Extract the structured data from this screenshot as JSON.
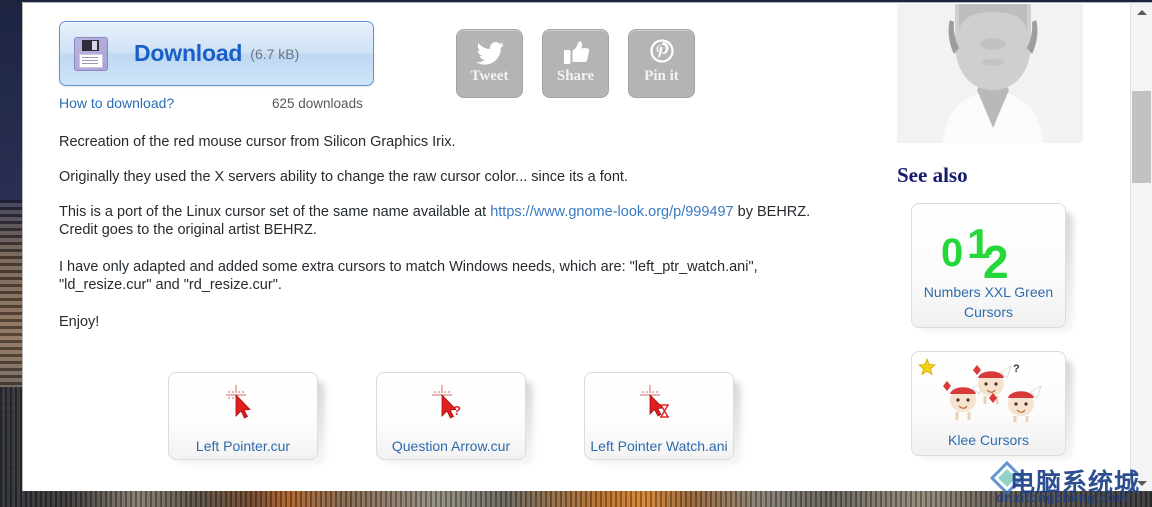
{
  "download": {
    "label": "Download",
    "size": "(6.7 kB)",
    "how_to": "How to download?",
    "count": "625 downloads",
    "icon": "floppy-disk-icon"
  },
  "social": [
    {
      "label": "Tweet",
      "icon": "twitter-bird-icon"
    },
    {
      "label": "Share",
      "icon": "thumbs-up-icon"
    },
    {
      "label": "Pin it",
      "icon": "pinterest-icon"
    }
  ],
  "description": {
    "p1": "Recreation of the red mouse cursor from Silicon Graphics Irix.",
    "p2": "Originally they used the X servers ability to change the raw cursor color... since its a font.",
    "p3_before": "This is a port of the Linux cursor set of the same name available at ",
    "p3_link": "https://www.gnome-look.org/p/999497",
    "p3_after": " by BEHRZ.",
    "p3_line2": "Credit goes to the original artist BEHRZ.",
    "p4_line1": "I have only adapted and added some extra cursors to match Windows needs, which are: \"left_ptr_watch.ani\",",
    "p4_line2": "\"ld_resize.cur\" and \"rd_resize.cur\".",
    "p5": "Enjoy!"
  },
  "previews": [
    {
      "caption": "Left Pointer.cur",
      "icon": "red-arrow-cursor-icon"
    },
    {
      "caption": "Question Arrow.cur",
      "icon": "red-arrow-question-cursor-icon"
    },
    {
      "caption": "Left Pointer Watch.ani",
      "icon": "red-arrow-hourglass-cursor-icon"
    }
  ],
  "sidebar": {
    "avatar": "user-avatar-silhouette",
    "see_also_title": "See also",
    "items": [
      {
        "caption": "Numbers XXL Green Cursors",
        "art": "green-numbers-012-icon",
        "featured": false
      },
      {
        "caption": "Klee Cursors",
        "art": "klee-characters-icon",
        "featured": true,
        "badge": "star-icon"
      }
    ]
  },
  "scrollbar": {
    "up": "scroll-up-arrow",
    "down": "scroll-down-arrow"
  },
  "watermark": {
    "cn": "电脑系统城",
    "en": "dnxitongcheng.com"
  },
  "colors": {
    "link": "#2b6cb8",
    "download_text": "#1a5fc8",
    "see_also": "#141a6e",
    "social_bg": "#b4b4b4",
    "cursor_red": "#e02020",
    "numbers_green": "#24d83a"
  }
}
